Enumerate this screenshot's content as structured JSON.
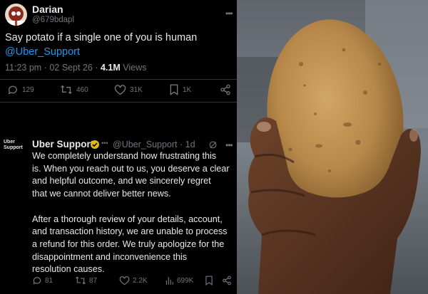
{
  "tweet1": {
    "name": "Darian",
    "handle": "@679bdapl",
    "text": "Say potato if a single one of you is human",
    "mention": "@Uber_Support",
    "time": "11:23 pm",
    "separator": "·",
    "date": "02 Sept 26",
    "views_count": "4.1M",
    "views_label": "Views",
    "more_icon": "•••",
    "stats": {
      "replies": "129",
      "reposts": "460",
      "likes": "31K",
      "bookmarks": "1K"
    }
  },
  "tweet2": {
    "avatar_line1": "Uber",
    "avatar_line2": "Support",
    "name": "Uber Support",
    "affiliate_dots": "•••",
    "handle": "@Uber_Support · 1d",
    "more_icon": "•••",
    "paragraph1": [
      "We completely understand how frustrating this",
      "is. When you reach out to us, you deserve a clear",
      "and helpful outcome, and we sincerely regret",
      "that we cannot deliver better news."
    ],
    "paragraph2": [
      "After a thorough review of your details, account,",
      "and transaction history, we are unable to process",
      "a refund for this order. We truly apologize for the",
      "disappointment and inconvenience this",
      "resolution causes."
    ],
    "stats": {
      "replies": "81",
      "reposts": "87",
      "likes": "2.2K",
      "views": "699K"
    }
  },
  "colors": {
    "background": "#000000",
    "text": "#e7e9ea",
    "muted": "#71767b",
    "link": "#1d9bf0",
    "divider": "#2f3336",
    "badge": "#e2b719",
    "potato": "#b8894a",
    "skin": "#5a3522"
  },
  "icons": [
    "reply-icon",
    "repost-icon",
    "like-icon",
    "bookmark-icon",
    "share-icon",
    "views-icon",
    "grok-icon",
    "more-icon",
    "verified-badge-icon"
  ]
}
